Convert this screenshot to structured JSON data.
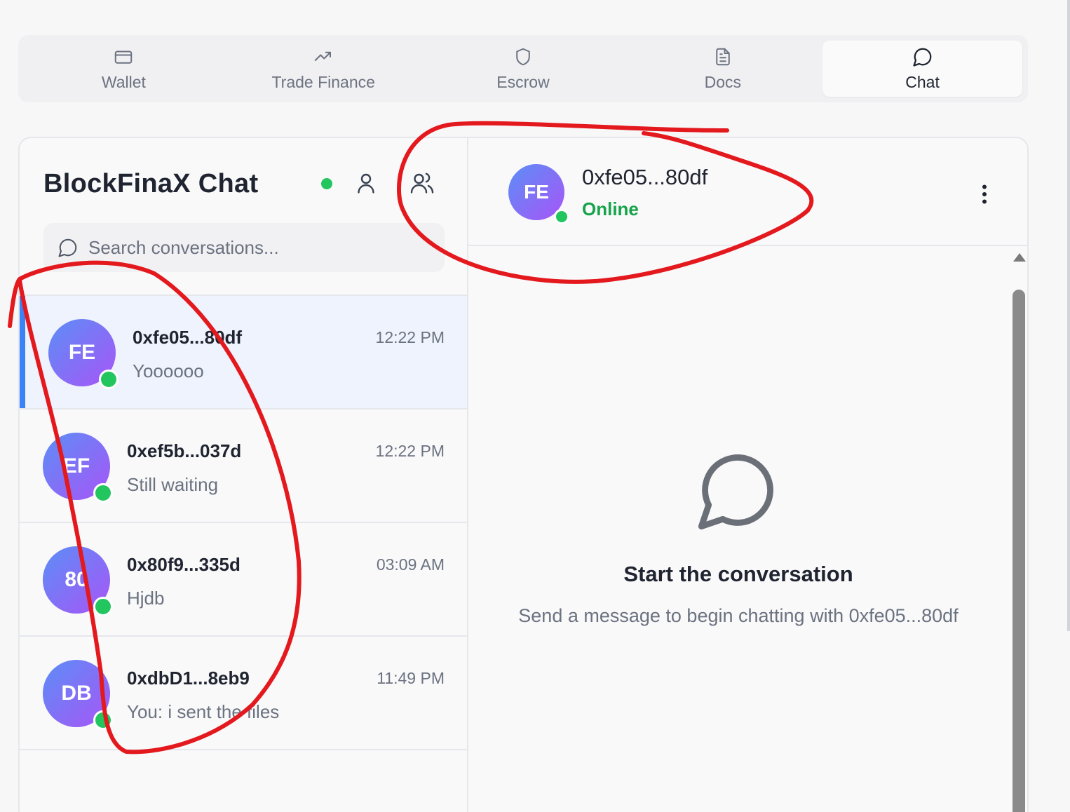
{
  "tabs": [
    {
      "label": "Wallet",
      "icon": "wallet-icon",
      "active": false
    },
    {
      "label": "Trade Finance",
      "icon": "trending-up-icon",
      "active": false
    },
    {
      "label": "Escrow",
      "icon": "shield-icon",
      "active": false
    },
    {
      "label": "Docs",
      "icon": "document-icon",
      "active": false
    },
    {
      "label": "Chat",
      "icon": "chat-bubble-icon",
      "active": true
    }
  ],
  "sidebar": {
    "title": "BlockFinaX Chat",
    "status_color": "#22c55e",
    "search": {
      "placeholder": "Search conversations...",
      "value": ""
    },
    "conversations": [
      {
        "initials": "FE",
        "name": "0xfe05...80df",
        "time": "12:22 PM",
        "preview": "Yoooooo",
        "selected": true,
        "online": true
      },
      {
        "initials": "EF",
        "name": "0xef5b...037d",
        "time": "12:22 PM",
        "preview": "Still waiting",
        "selected": false,
        "online": true
      },
      {
        "initials": "80",
        "name": "0x80f9...335d",
        "time": "03:09 AM",
        "preview": "Hjdb",
        "selected": false,
        "online": true
      },
      {
        "initials": "DB",
        "name": "0xdbD1...8eb9",
        "time": "11:49 PM",
        "preview": "You: i sent the files",
        "selected": false,
        "online": true
      }
    ]
  },
  "chat": {
    "avatar_initials": "FE",
    "name": "0xfe05...80df",
    "status": "Online",
    "empty_title": "Start the conversation",
    "empty_subtitle": "Send a message to begin chatting with 0xfe05...80df"
  },
  "colors": {
    "accent": "#3b82f6",
    "online": "#22c55e",
    "status_text": "#16a34a",
    "annotation": "#e3191e",
    "avatar_gradient": [
      "#5b8ef6",
      "#a855f7"
    ]
  }
}
